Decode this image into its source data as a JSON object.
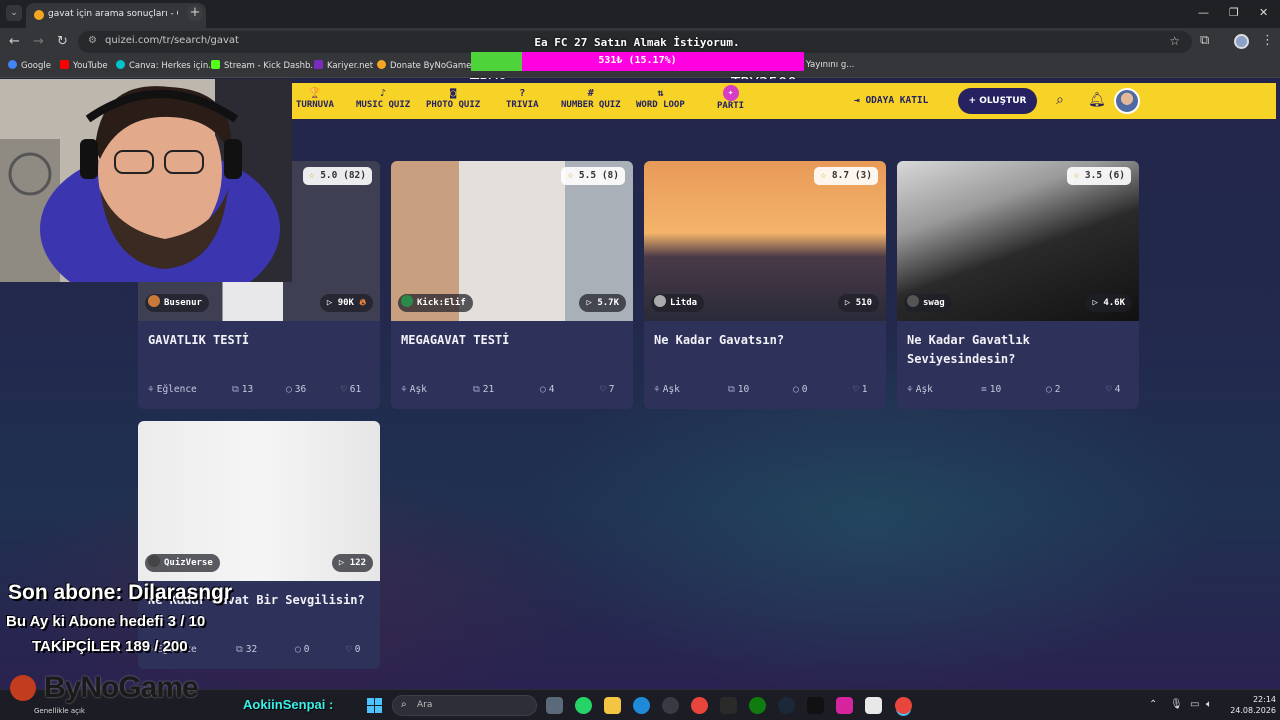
{
  "browser": {
    "tab_title": "gavat için arama sonuçları - Quizei",
    "url": "quizei.com/tr/search/gavat",
    "bookmarks": [
      {
        "label": "Google",
        "color": "#4285f4"
      },
      {
        "label": "YouTube",
        "color": "#ff0000"
      },
      {
        "label": "Canva: Herkes için...",
        "color": "#00c4cc"
      },
      {
        "label": "Stream - Kick Dashb...",
        "color": "#53fc18"
      },
      {
        "label": "Kariyer.net",
        "color": "#7b2cbf"
      },
      {
        "label": "Donate ByNoGame...",
        "color": "#f5a623"
      },
      {
        "label": "Yayınını g...",
        "color": "#888888"
      }
    ]
  },
  "donation": {
    "title": "Ea FC 27 Satın Almak İstiyorum.",
    "amount": "531₺ (15.17%)",
    "progress": 0.1517,
    "min_label": "TRY0",
    "max_label": "TRY3500"
  },
  "site": {
    "nav": [
      {
        "label": "TURNUVA",
        "icon": "trophy-icon",
        "glyph": "🏆"
      },
      {
        "label": "MUSIC QUIZ",
        "icon": "music-note-icon",
        "glyph": "♪"
      },
      {
        "label": "PHOTO QUIZ",
        "icon": "camera-icon",
        "glyph": "◙"
      },
      {
        "label": "TRIVIA",
        "icon": "question-icon",
        "glyph": "?"
      },
      {
        "label": "NUMBER QUIZ",
        "icon": "hash-icon",
        "glyph": "#"
      },
      {
        "label": "WORD LOOP",
        "icon": "sort-icon",
        "glyph": "⇅"
      },
      {
        "label": "PARTI",
        "icon": "party-icon",
        "glyph": "✦"
      }
    ],
    "join_room": "ODAYA KATIL",
    "create": "+ OLUŞTUR"
  },
  "cards": [
    {
      "title": "GAVATLIK TESTİ",
      "rating": "5.0",
      "votes": "(82)",
      "author": "Busenur",
      "plays": "90K",
      "hot": true,
      "category": "Eğlence",
      "questions": "13",
      "comments": "36",
      "likes": "61",
      "author_color": "#c77a3a"
    },
    {
      "title": "MEGAGAVAT TESTİ",
      "rating": "5.5",
      "votes": "(8)",
      "author": "Kick:Elif",
      "plays": "5.7K",
      "hot": false,
      "category": "Aşk",
      "questions": "21",
      "comments": "4",
      "likes": "7",
      "author_color": "#2a8a4a"
    },
    {
      "title": "Ne Kadar Gavatsın?",
      "rating": "8.7",
      "votes": "(3)",
      "author": "Litda",
      "plays": "510",
      "hot": false,
      "category": "Aşk",
      "questions": "10",
      "comments": "0",
      "likes": "1",
      "author_color": "#aaaaaa"
    },
    {
      "title": "Ne Kadar Gavatlık Seviyesindesin?",
      "rating": "3.5",
      "votes": "(6)",
      "author": "swag",
      "plays": "4.6K",
      "hot": false,
      "category": "Aşk",
      "questions": "10",
      "comments": "2",
      "likes": "4",
      "author_color": "#555555"
    },
    {
      "title": "Ne Kadar Gavat Bir Sevgilisin?",
      "rating": "",
      "votes": "",
      "author": "QuizVerse",
      "plays": "122",
      "hot": false,
      "category": "Eğlence",
      "questions": "32",
      "comments": "0",
      "likes": "0",
      "author_color": "#444444"
    }
  ],
  "overlay": {
    "last_sub": "Son abone: Dilarasngr",
    "month_goal": "Bu Ay ki Abone hedefi 3 / 10",
    "followers": "TAKİPÇİLER 189 / 200",
    "brand": "ByNoGame",
    "chat_user": "AokiinSenpai :"
  },
  "taskbar": {
    "search_placeholder": "Ara",
    "weather": "Genellikle açık",
    "time": "22:14",
    "date": "24.08.2026"
  }
}
